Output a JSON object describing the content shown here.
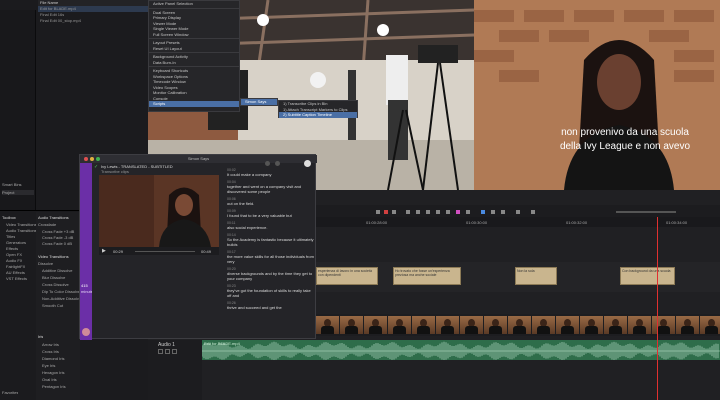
{
  "media_pool": {
    "column_header": "File Name",
    "files": [
      "Edit for BLADE.mp4",
      "Final Edit 16s",
      "Final Edit 00_stop.mp4"
    ],
    "smart_bins_label": "Smart Bins",
    "bins": [
      "Project"
    ],
    "favorites_label": "Favorites"
  },
  "menu": {
    "items": [
      "Active Panel Selection",
      "Dual Screen",
      "Primary Display",
      "Viewer Mode",
      "Single Viewer Mode",
      "Full Screen Window",
      "Layout Presets",
      "Reset UI Layout",
      "Background Activity",
      "Data Burn-In",
      "Keyboard Shortcuts",
      "Workspace Options",
      "Timecode Window",
      "Video Scopes",
      "Monitor Calibration",
      "Console",
      "Scripts"
    ],
    "selected": "Scripts",
    "submenu_item": "Simon Says",
    "submenu2_items": [
      "1) Transcribe Clips in Bin",
      "1) Attach Transcript Markers to Clips",
      "2) Subtitle Caption Timeline"
    ]
  },
  "tooltip": {
    "lines": [
      "time",
      "the thi...",
      "And I really had",
      "didn't know how to",
      "rejected from all the"
    ]
  },
  "viewer_right": {
    "subtitle_line1": "non provenivo da una scuola",
    "subtitle_line2": "della Ivy League e non avevo"
  },
  "transcript_window": {
    "title": "Simon Says",
    "project_name": "Ivy Lewis - TRANSLATED - SUBTITLED",
    "project_sub": "Transcribe clips",
    "time_current": "00:29",
    "time_total": "00:49",
    "sidebar_count_label": "415",
    "sidebar_count_sub": "minutes",
    "segments": [
      {
        "tc": "00:02",
        "text": "It could make a company"
      },
      {
        "tc": "00:04",
        "text": "together and went on a company visit and discovered some people"
      },
      {
        "tc": "00:06",
        "text": "out on the field."
      },
      {
        "tc": "00:09",
        "text": "I found that to be a very valuable but"
      },
      {
        "tc": "00:11",
        "text": "also social experience."
      },
      {
        "tc": "00:14",
        "text": "So the Academy is fantastic because it ultimately builds"
      },
      {
        "tc": "00:17",
        "text": "the more value skills for all those individuals from very"
      },
      {
        "tc": "00:20",
        "text": "diverse backgrounds and by the time they get to your company"
      },
      {
        "tc": "00:23",
        "text": "they've got the foundation of skills to really take off and"
      },
      {
        "tc": "00:26",
        "text": "thrive and succeed and get the"
      }
    ]
  },
  "effects_panel": {
    "toolbox_label": "Toolbox",
    "toolbox_items": [
      "Video Transitions",
      "Audio Transitions",
      "Titles",
      "Generators",
      "Effects",
      "Open FX",
      "Audio FX",
      "FairlightFX",
      "AU Effects",
      "VST Effects"
    ],
    "audio_transitions_label": "Audio Transitions",
    "audio_transitions_sub": "Crossfade",
    "audio_transitions": [
      "Cross Fade +3 dB",
      "Cross Fade -3 dB",
      "Cross Fade 0 dB"
    ],
    "video_transitions_label": "Video Transitions",
    "video_transitions_sub": "Dissolve",
    "video_transitions": [
      "Additive Dissolve",
      "Blur Dissolve",
      "Cross Dissolve",
      "Dip To Color Dissolve",
      "Non-Additive Dissolve",
      "Smooth Cut"
    ],
    "iris_label": "Iris",
    "iris_items": [
      "Arrow Iris",
      "Cross Iris",
      "Diamond Iris",
      "Eye Iris",
      "Hexagon Iris",
      "Oval Iris",
      "Pentagon Iris"
    ]
  },
  "timeline": {
    "ruler_labels": [
      "01:00:28:00",
      "01:00:30:00",
      "01:00:32:00",
      "01:00:34:00"
    ],
    "subtitle_clips": [
      "esperienza di lavoro in una società con dipendenti",
      "Ho trovato che fosse un'esperienza preziosa ma anche sociale",
      "Non la sola",
      "Con background da una scuola"
    ],
    "audio_track_label": "Audio 1",
    "audio_clip_label": "Edit for BLADE.mp4"
  },
  "colors": {
    "accent_purple": "#6b2fa7",
    "audio_green": "#2e6d4a",
    "subtitle_clip": "#c9b58e",
    "playhead": "#e03030",
    "menu_selection": "#4a6fa5"
  }
}
